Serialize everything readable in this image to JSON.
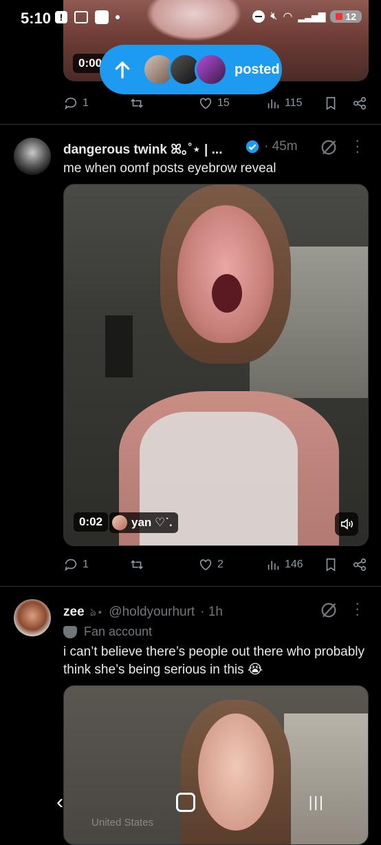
{
  "status_bar": {
    "time": "5:10",
    "battery": "12",
    "network": "6"
  },
  "top_post": {
    "video_time": "0:00",
    "actions": {
      "replies": "1",
      "retweets": "",
      "likes": "15",
      "views": "115"
    }
  },
  "posted_pill": {
    "label": "posted"
  },
  "post1": {
    "display_name": "dangerous twink ꕤ｡˚⋆ | ...",
    "verified": true,
    "time": "· 45m",
    "text": "me when oomf posts eyebrow reveal",
    "video_time": "0:02",
    "video_user": "yan ♡˙.",
    "actions": {
      "replies": "1",
      "retweets": "",
      "likes": "2",
      "views": "146"
    }
  },
  "post2": {
    "display_name": "zee",
    "name_decoration": "ঌ⋆",
    "handle": "@holdyourhurt",
    "time": "· 1h",
    "label": "Fan account",
    "text": "i can’t believe there’s people out there who probably think she’s being serious in this 😭",
    "video_watermark": "United States"
  },
  "colors": {
    "accent": "#1d9bf0",
    "muted": "#71767b",
    "background": "#000000"
  }
}
